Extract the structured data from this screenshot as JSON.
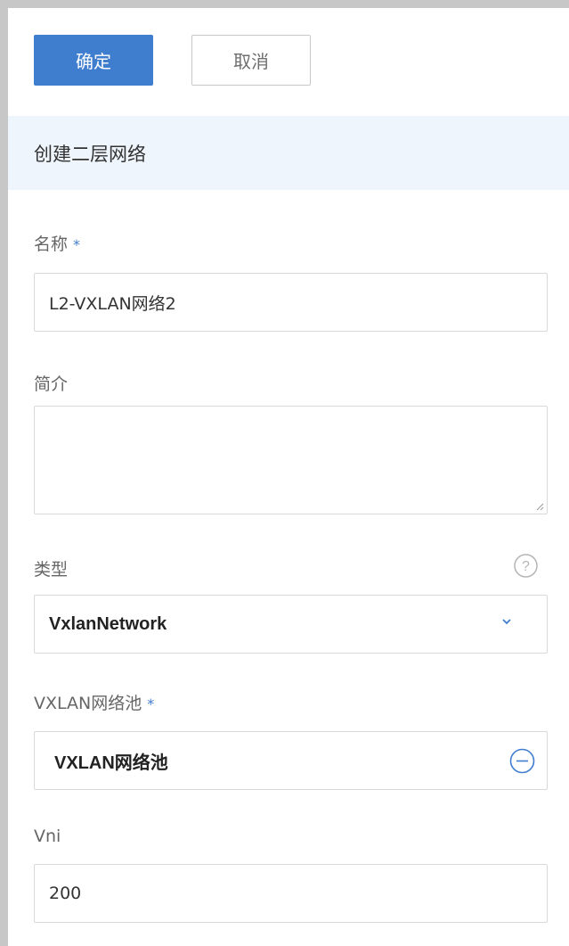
{
  "toolbar": {
    "confirm_label": "确定",
    "cancel_label": "取消"
  },
  "section": {
    "title": "创建二层网络"
  },
  "form": {
    "name": {
      "label": "名称",
      "required_mark": "*",
      "value": "L2-VXLAN网络2"
    },
    "description": {
      "label": "简介",
      "value": ""
    },
    "type": {
      "label": "类型",
      "value": "VxlanNetwork",
      "help_icon": "question-circle-icon",
      "dropdown_icon": "chevron-down-icon"
    },
    "vxlan_pool": {
      "label": "VXLAN网络池",
      "required_mark": "*",
      "value": "VXLAN网络池",
      "remove_icon": "minus-circle-icon"
    },
    "vni": {
      "label": "Vni",
      "value": "200"
    }
  },
  "colors": {
    "primary": "#3f7dcf",
    "header_bg": "#eef5fc",
    "border": "#d9d9d9"
  }
}
